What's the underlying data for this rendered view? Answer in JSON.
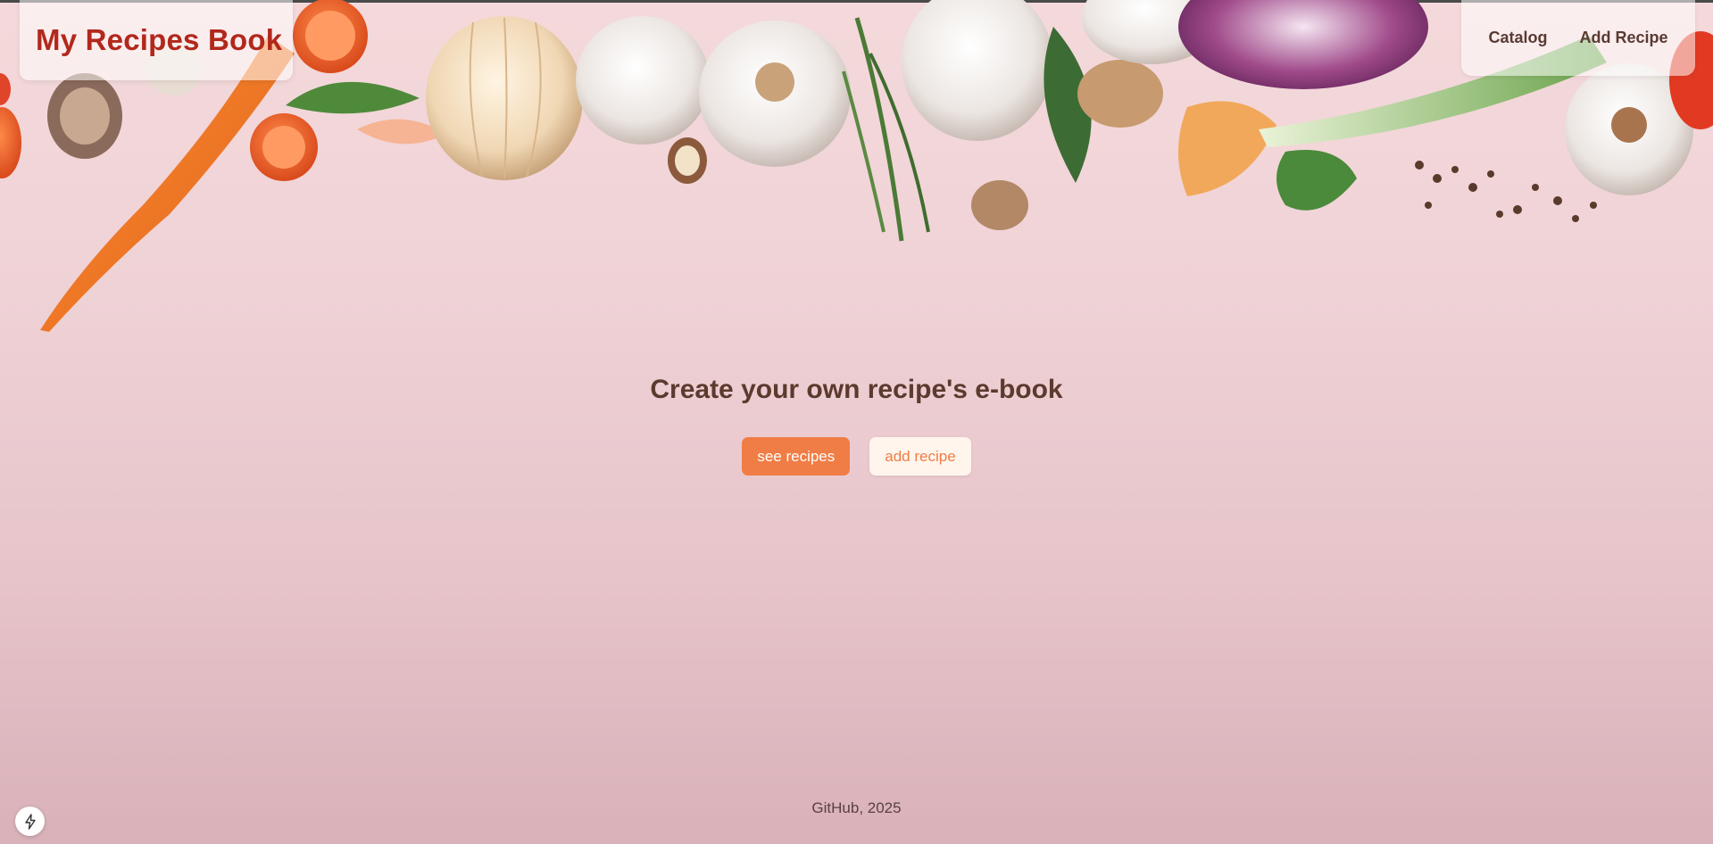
{
  "header": {
    "logo_title": "My Recipes Book",
    "nav": [
      {
        "label": "Catalog"
      },
      {
        "label": "Add Recipe"
      }
    ]
  },
  "hero": {
    "title": "Create your own recipe's e-book",
    "buttons": {
      "see_recipes": "see recipes",
      "add_recipe": "add recipe"
    }
  },
  "footer": {
    "text": "GitHub, 2025"
  },
  "dev_badge": {
    "icon": "lightning-bolt-icon"
  },
  "colors": {
    "logo": "#b2281c",
    "accent": "#f07d45",
    "text_dark": "#5c3a2e",
    "background": "#f1d4d8"
  }
}
